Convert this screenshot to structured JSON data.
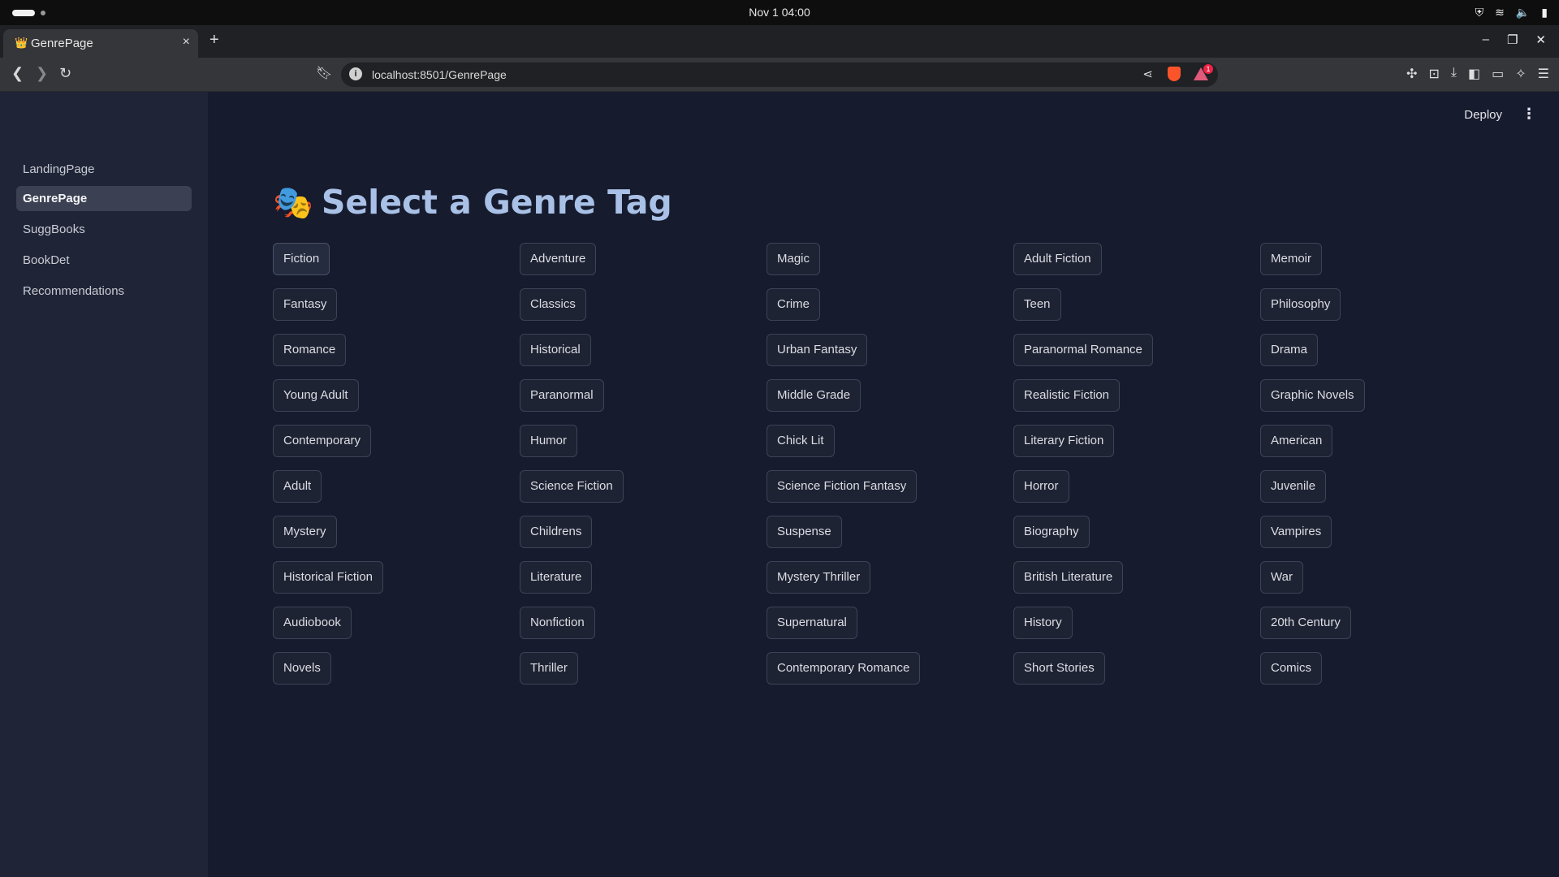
{
  "os": {
    "clock": "Nov 1  04:00"
  },
  "browser": {
    "tab_title": "GenrePage",
    "url": "localhost:8501/GenrePage",
    "badge_count": "1"
  },
  "sidebar": {
    "items": [
      {
        "label": "LandingPage",
        "active": false
      },
      {
        "label": "GenrePage",
        "active": true
      },
      {
        "label": "SuggBooks",
        "active": false
      },
      {
        "label": "BookDet",
        "active": false
      },
      {
        "label": "Recommendations",
        "active": false
      }
    ]
  },
  "header": {
    "deploy_label": "Deploy"
  },
  "main": {
    "title_emoji": "🎭",
    "title": "Select a Genre Tag",
    "genres": [
      "Fiction",
      "Adventure",
      "Magic",
      "Adult Fiction",
      "Memoir",
      "Fantasy",
      "Classics",
      "Crime",
      "Teen",
      "Philosophy",
      "Romance",
      "Historical",
      "Urban Fantasy",
      "Paranormal Romance",
      "Drama",
      "Young Adult",
      "Paranormal",
      "Middle Grade",
      "Realistic Fiction",
      "Graphic Novels",
      "Contemporary",
      "Humor",
      "Chick Lit",
      "Literary Fiction",
      "American",
      "Adult",
      "Science Fiction",
      "Science Fiction Fantasy",
      "Horror",
      "Juvenile",
      "Mystery",
      "Childrens",
      "Suspense",
      "Biography",
      "Vampires",
      "Historical Fiction",
      "Literature",
      "Mystery Thriller",
      "British Literature",
      "War",
      "Audiobook",
      "Nonfiction",
      "Supernatural",
      "History",
      "20th Century",
      "Novels",
      "Thriller",
      "Contemporary Romance",
      "Short Stories",
      "Comics"
    ]
  }
}
